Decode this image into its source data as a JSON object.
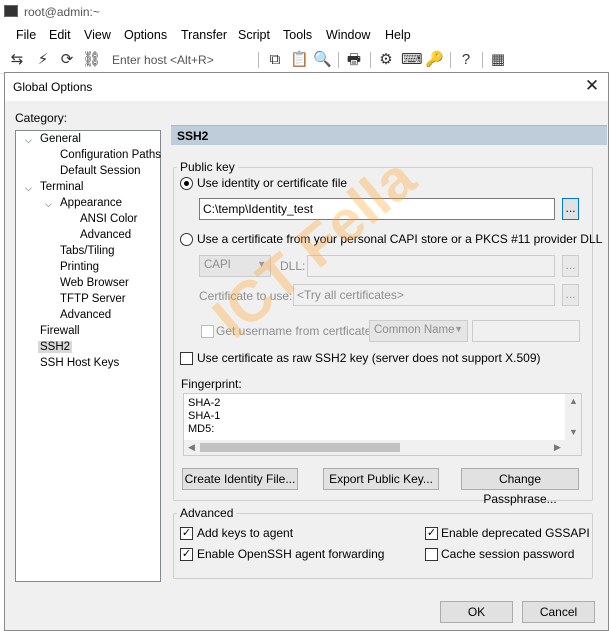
{
  "app": {
    "title": "root@admin:~",
    "menu": [
      "File",
      "Edit",
      "View",
      "Options",
      "Transfer",
      "Script",
      "Tools",
      "Window",
      "Help"
    ],
    "toolbar_host_placeholder": "Enter host <Alt+R>"
  },
  "dialog": {
    "title": "Global Options",
    "category_label": "Category:",
    "tree": [
      {
        "label": "General",
        "level": 0,
        "expanded": true
      },
      {
        "label": "Configuration Paths",
        "level": 1
      },
      {
        "label": "Default Session",
        "level": 1
      },
      {
        "label": "Terminal",
        "level": 0,
        "expanded": true
      },
      {
        "label": "Appearance",
        "level": 1,
        "expanded": true
      },
      {
        "label": "ANSI Color",
        "level": 2
      },
      {
        "label": "Advanced",
        "level": 2
      },
      {
        "label": "Tabs/Tiling",
        "level": 1
      },
      {
        "label": "Printing",
        "level": 1
      },
      {
        "label": "Web Browser",
        "level": 1
      },
      {
        "label": "TFTP Server",
        "level": 1
      },
      {
        "label": "Advanced",
        "level": 1
      },
      {
        "label": "Firewall",
        "level": 0
      },
      {
        "label": "SSH2",
        "level": 0,
        "selected": true
      },
      {
        "label": "SSH Host Keys",
        "level": 0
      }
    ],
    "panel_title": "SSH2",
    "public_key": {
      "group_label": "Public key",
      "use_identity_label": "Use identity or certificate file",
      "use_identity_selected": true,
      "identity_path": "C:\\temp\\Identity_test",
      "browse_label": "...",
      "use_capi_label": "Use a certificate from your personal CAPI store or a PKCS #11 provider DLL",
      "capi_option": "CAPI",
      "dll_label": "DLL:",
      "cert_to_use_label": "Certificate to use:",
      "cert_to_use_value": "<Try all certificates>",
      "get_username_label": "Get username from certficate:",
      "common_name_option": "Common Name",
      "raw_ssh2_label": "Use certificate as raw SSH2 key (server does not support X.509)",
      "fingerprint_label": "Fingerprint:",
      "fingerprint_lines": [
        "SHA-2",
        "SHA-1",
        "MD5:"
      ],
      "buttons": {
        "create_identity": "Create Identity File...",
        "export_public": "Export Public Key...",
        "change_passphrase": "Change Passphrase..."
      }
    },
    "advanced": {
      "group_label": "Advanced",
      "add_keys_label": "Add keys to agent",
      "add_keys_checked": true,
      "openssh_fwd_label": "Enable OpenSSH agent forwarding",
      "openssh_fwd_checked": true,
      "gssapi_label": "Enable deprecated GSSAPI",
      "gssapi_checked": true,
      "cache_pw_label": "Cache session password",
      "cache_pw_checked": false
    },
    "ok_label": "OK",
    "cancel_label": "Cancel"
  },
  "watermark_text": "ICT Fella"
}
